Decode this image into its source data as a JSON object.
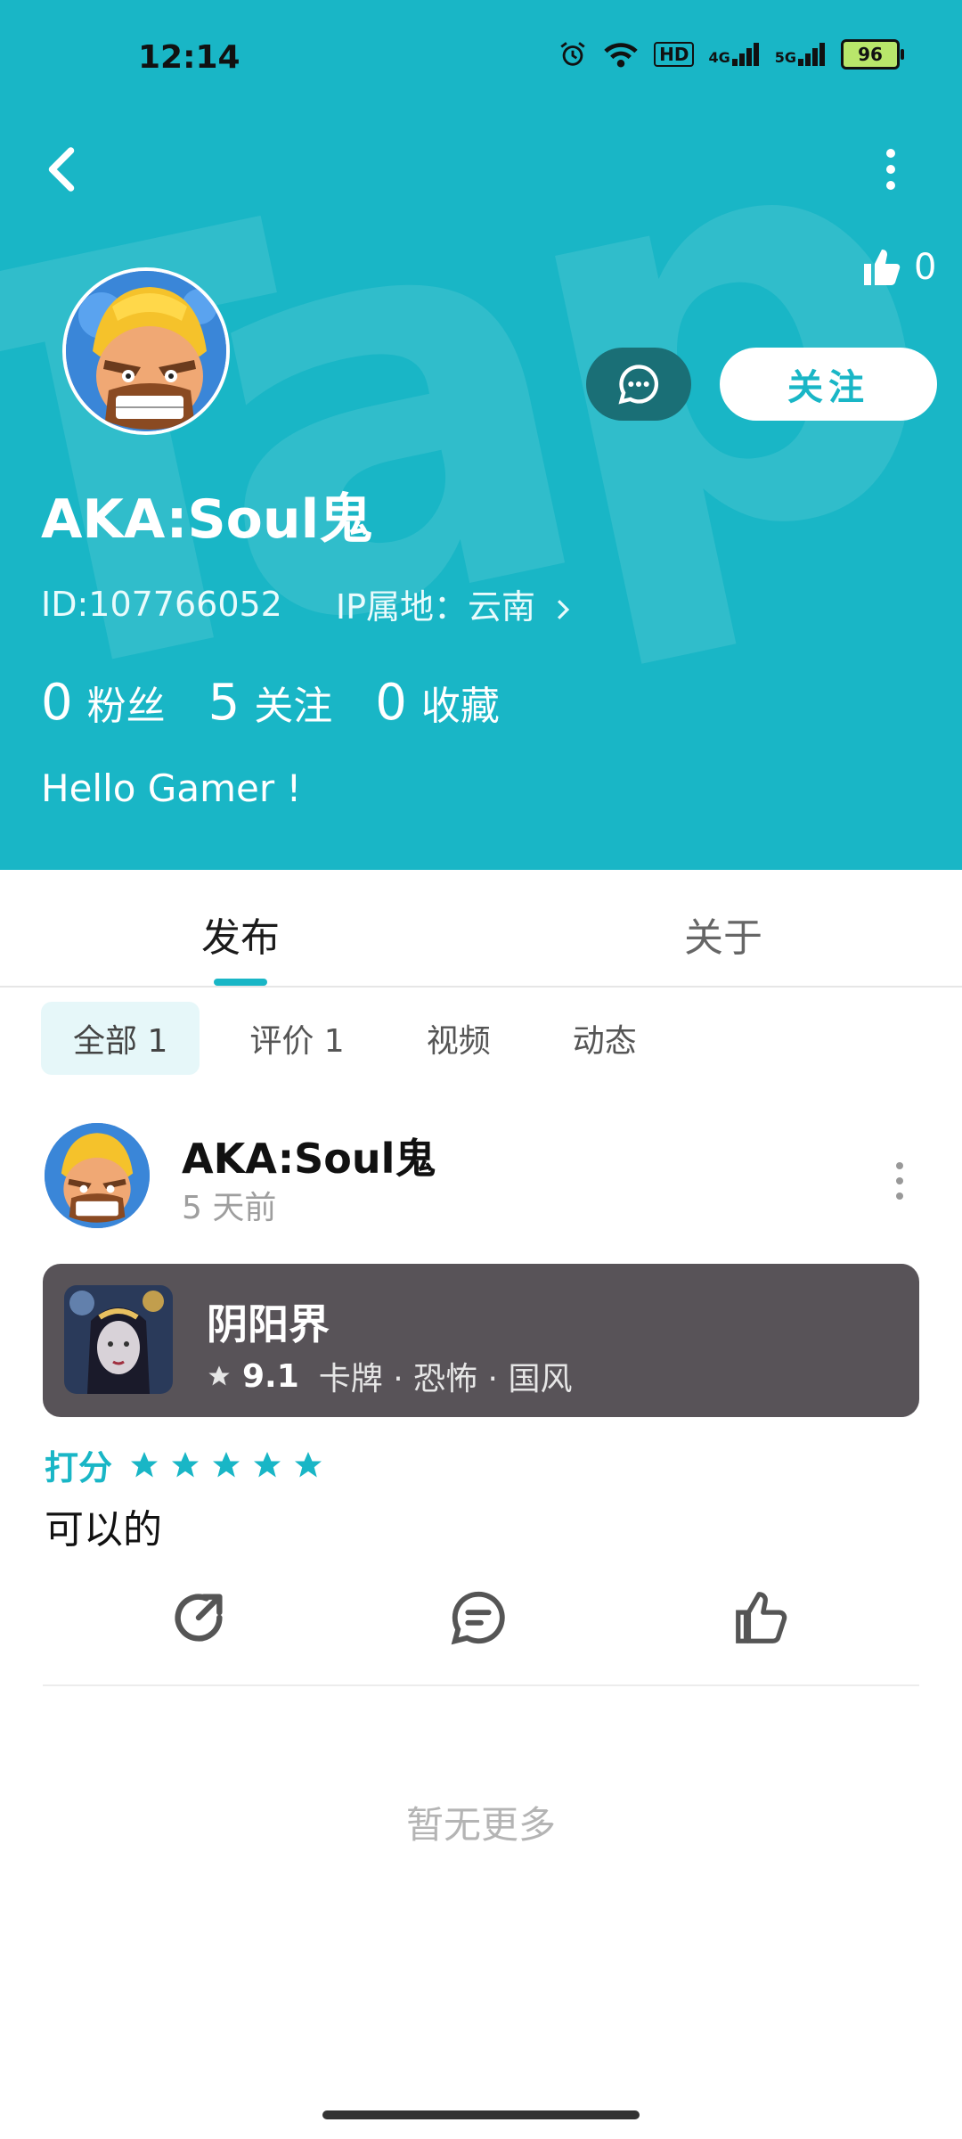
{
  "status_bar": {
    "time": "12:14",
    "network_4g": "4G",
    "network_5g": "5G",
    "hd_label": "HD",
    "battery": "96"
  },
  "header": {
    "like_count": "0",
    "follow_label": "关注",
    "username": "AKA:Soul鬼",
    "id_text": "ID:107766052",
    "ip_text": "IP属地：云南",
    "stats": {
      "fans_count": "0",
      "fans_label": "粉丝",
      "following_count": "5",
      "following_label": "关注",
      "favorites_count": "0",
      "favorites_label": "收藏"
    },
    "bio": "Hello Gamer !",
    "bg_color": "#19B6C6"
  },
  "tabs": {
    "publish": "发布",
    "about": "关于"
  },
  "filters": [
    {
      "label": "全部 1",
      "active": true
    },
    {
      "label": "评价 1",
      "active": false
    },
    {
      "label": "视频",
      "active": false
    },
    {
      "label": "动态",
      "active": false
    }
  ],
  "post": {
    "author": "AKA:Soul鬼",
    "time": "5 天前",
    "game": {
      "title": "阴阳界",
      "rating": "9.1",
      "tags": "卡牌 · 恐怖 · 国风"
    },
    "score_label": "打分",
    "stars": 5,
    "text": "可以的"
  },
  "footer": {
    "no_more": "暂无更多"
  },
  "icons": {
    "back": "back-arrow-icon",
    "menu": "more-vertical-icon",
    "like": "thumbs-up-icon",
    "message": "chat-bubble-icon",
    "share": "share-icon",
    "comment": "comment-icon",
    "star": "star-icon"
  }
}
